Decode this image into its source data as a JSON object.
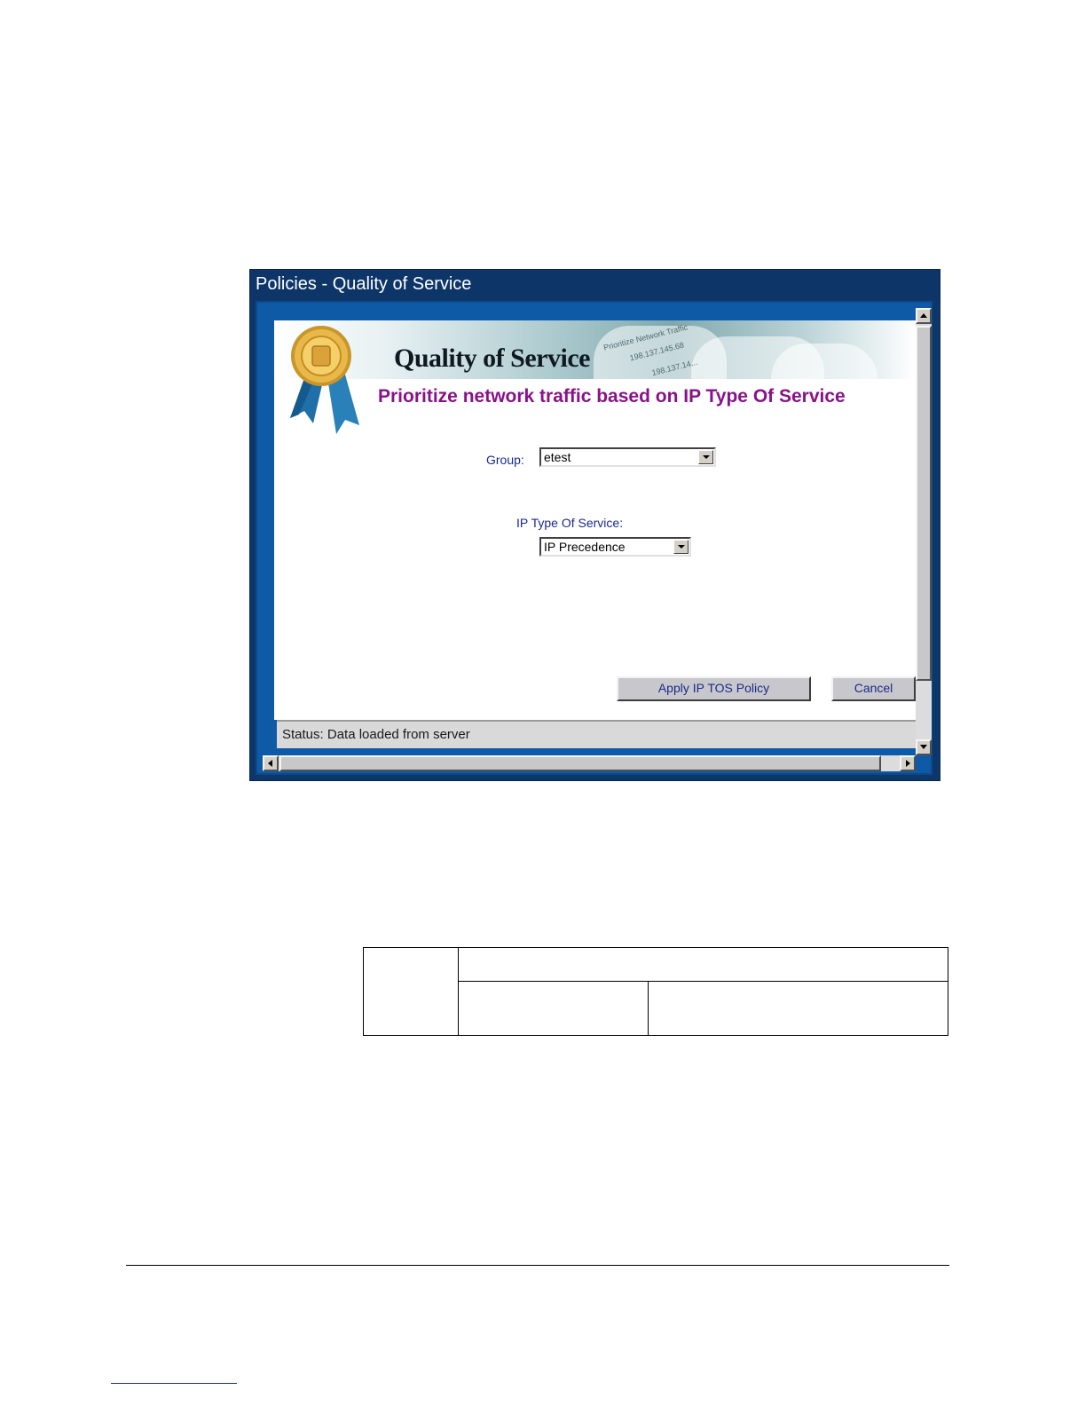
{
  "window": {
    "title": "Policies - Quality of Service",
    "banner": {
      "heading": "Quality of Service",
      "background_text": [
        "Prioritize Network Traffic",
        "198.137.145.68",
        "198.137.14..."
      ]
    },
    "subtitle": "Prioritize network traffic based on IP Type Of Service",
    "group": {
      "label": "Group:",
      "value": "etest"
    },
    "tos": {
      "label": "IP Type Of Service:",
      "value": "IP Precedence"
    },
    "buttons": {
      "apply": "Apply IP TOS Policy",
      "cancel": "Cancel"
    },
    "status": "Status:  Data loaded from server",
    "colors": {
      "title_bar": "#0d3568",
      "frame": "#0f5aa6",
      "subtitle": "#8a1289",
      "label": "#1a2a8a"
    }
  }
}
